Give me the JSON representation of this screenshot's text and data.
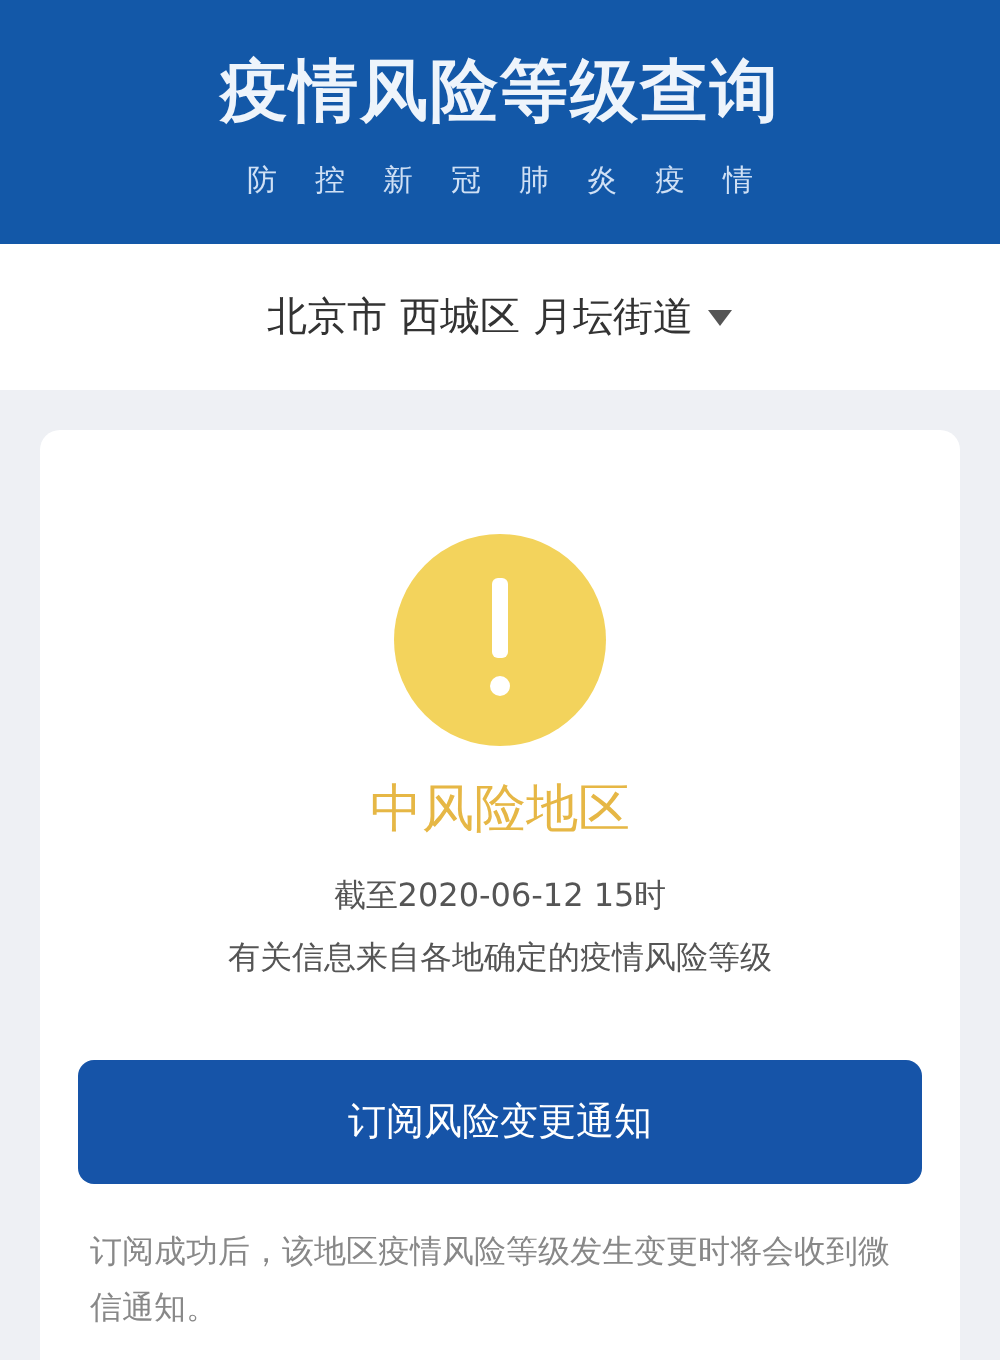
{
  "header": {
    "title": "疫情风险等级查询",
    "subtitle": [
      "防",
      "控",
      "新",
      "冠",
      "肺",
      "炎",
      "疫",
      "情"
    ]
  },
  "location": {
    "text": "北京市 西城区 月坛街道"
  },
  "result": {
    "kind": "medium",
    "level_label": "中风险地区",
    "updated": "截至2020-06-12 15时",
    "note": "有关信息来自各地确定的疫情风险等级"
  },
  "subscribe_button": "订阅风险变更通知",
  "footnote": "订阅成功后，该地区疫情风险等级发生变更时将会收到微信通知。"
}
